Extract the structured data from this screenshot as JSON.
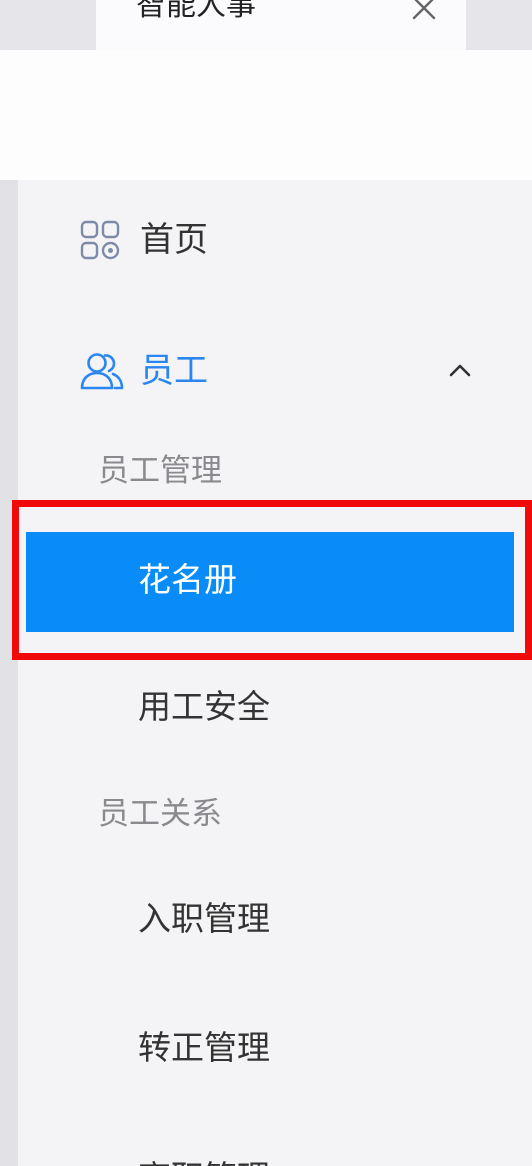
{
  "app_tab": {
    "title": "智能人事",
    "close_icon": "close-icon"
  },
  "menu": {
    "home": {
      "label": "首页",
      "icon": "grid-apps-icon"
    },
    "staff": {
      "label": "员工",
      "icon": "users-icon",
      "expanded": true,
      "color": "#2a86f0"
    },
    "groups": {
      "manage": {
        "title": "员工管理",
        "items": {
          "roster": "花名册",
          "safety": "用工安全"
        }
      },
      "relation": {
        "title": "员工关系",
        "items": {
          "onboard": "入职管理",
          "regular": "转正管理",
          "leave": "离职管理"
        }
      }
    }
  },
  "colors": {
    "active_bg": "#0a8cf8",
    "highlight_border": "#f00a0a",
    "accent": "#2a86f0"
  }
}
